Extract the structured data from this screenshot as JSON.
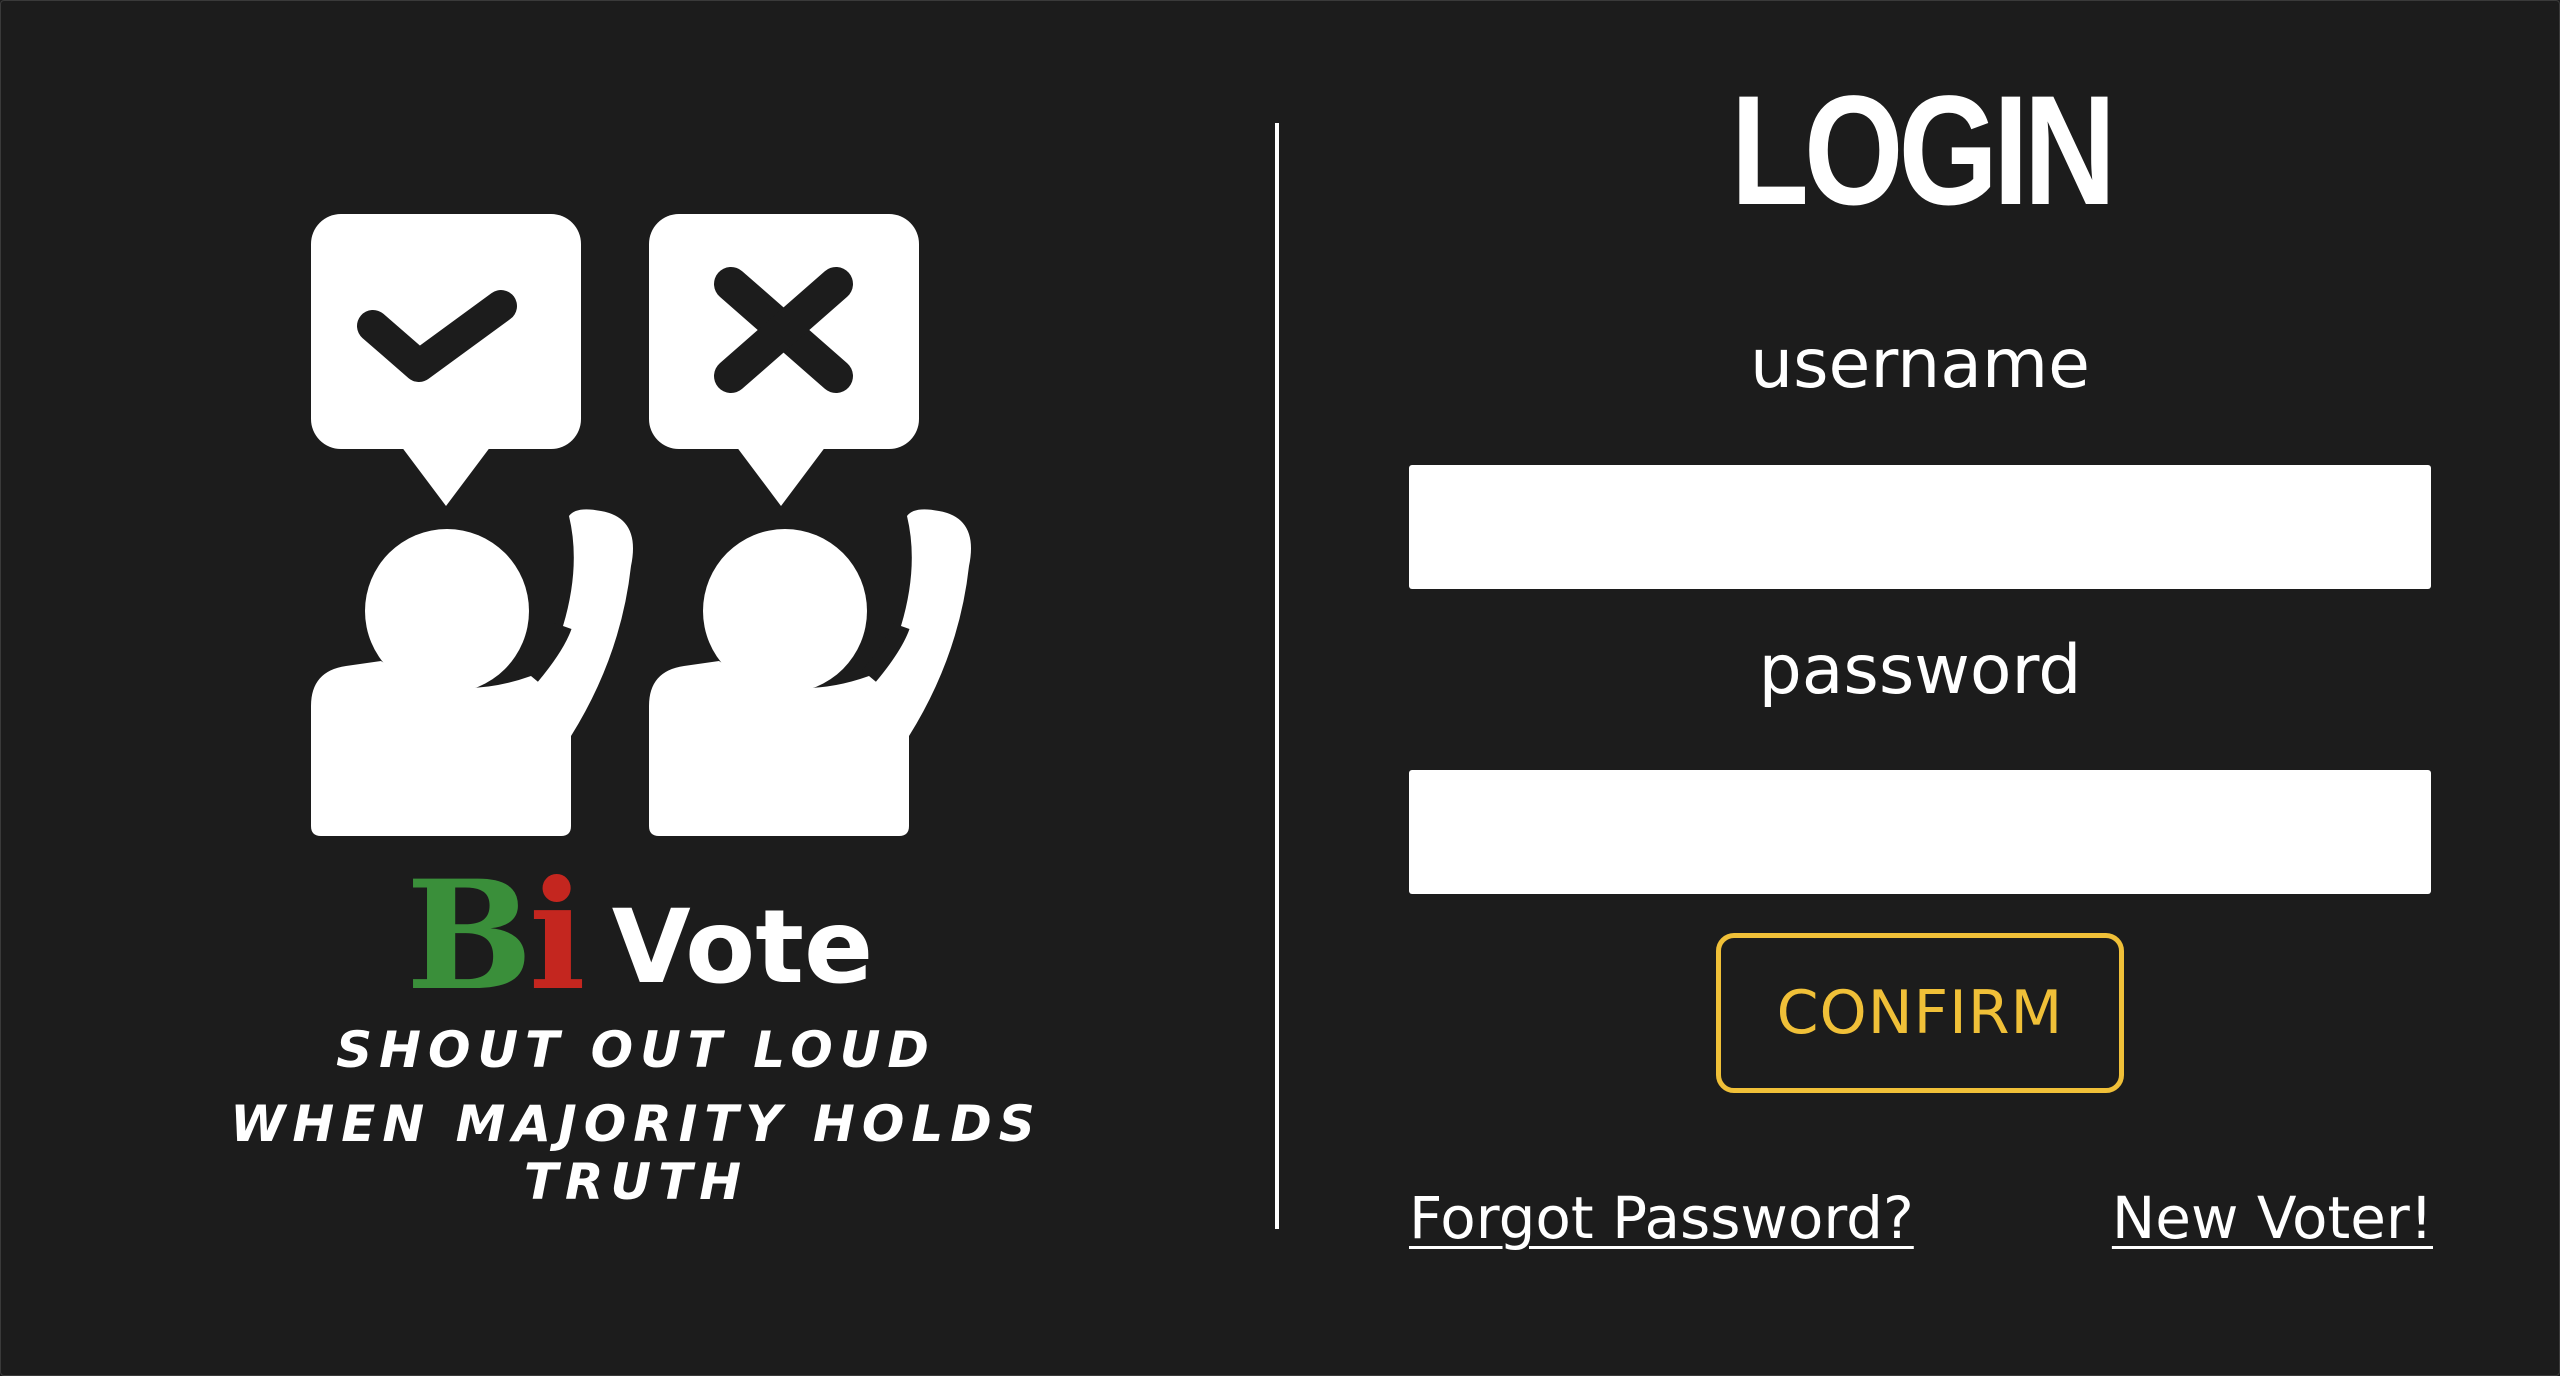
{
  "brand": {
    "name_part1": "B",
    "name_part2": "i",
    "name_part3": "Vote",
    "tagline_line1": "Shout out loud",
    "tagline_line2": "When majority holds truth",
    "colors": {
      "green": "#3a8f3a",
      "red": "#c4261f",
      "white": "#ffffff"
    },
    "logo_icons": [
      "check-bubble-icon",
      "x-bubble-icon",
      "raised-hand-person-icon",
      "raised-hand-person-icon"
    ]
  },
  "login": {
    "title": "LOGIN",
    "username_label": "username",
    "username_value": "",
    "password_label": "password",
    "password_value": "",
    "confirm_label": "CONFIRM",
    "forgot_link": "Forgot Password?",
    "new_voter_link": "New Voter!"
  },
  "theme": {
    "background": "#1c1c1c",
    "accent": "#f0c038"
  }
}
